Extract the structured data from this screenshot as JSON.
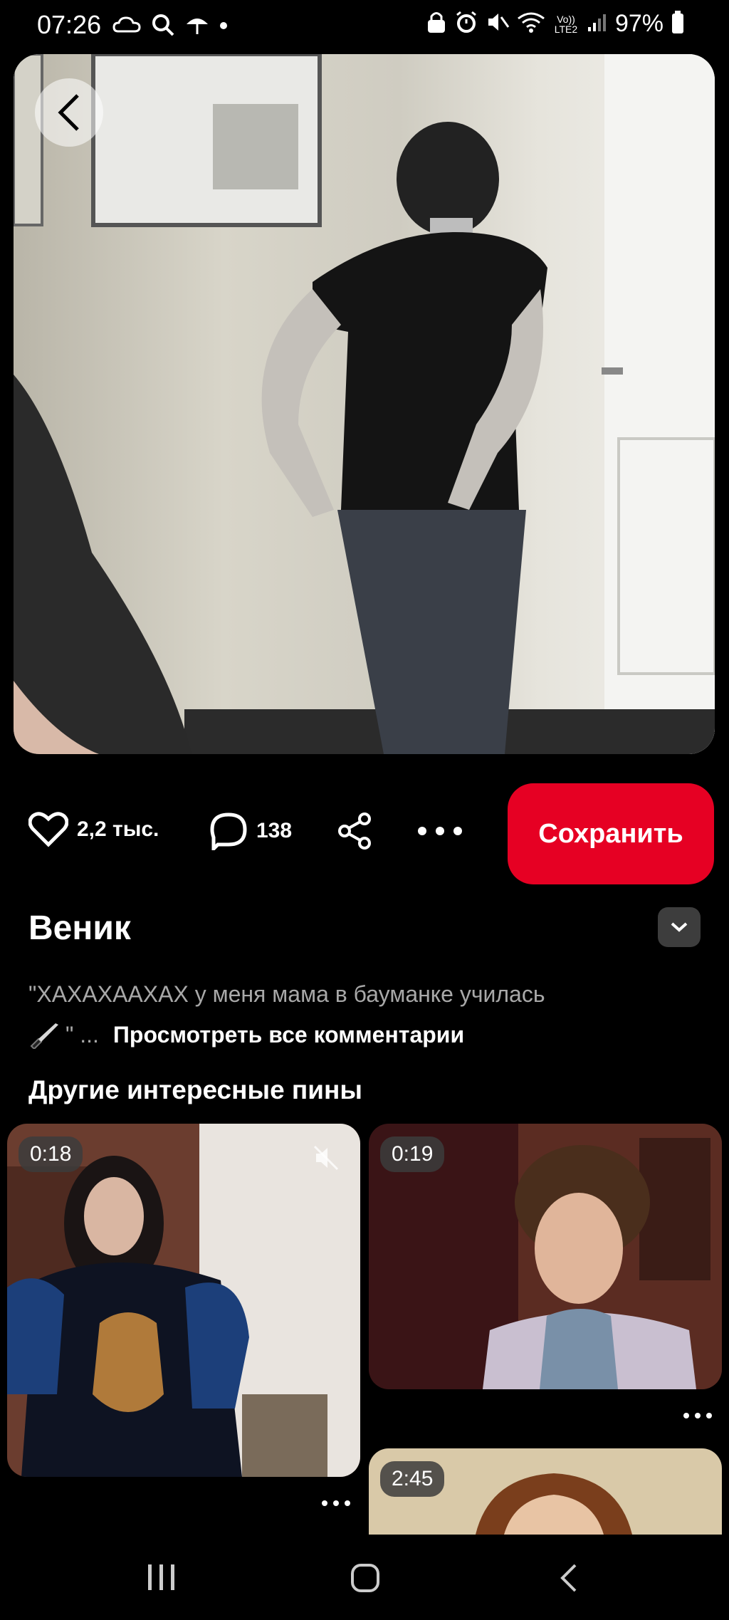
{
  "status_bar": {
    "time": "07:26",
    "battery": "97%",
    "left_icons": [
      "cloud-icon",
      "search-icon",
      "umbrella-icon",
      "dot-icon"
    ],
    "right_icons": [
      "lock-icon",
      "alarm-icon",
      "mute-icon",
      "wifi-icon",
      "volte-icon",
      "signal-icon",
      "battery-icon"
    ],
    "volte_label": "Vo)) LTE2"
  },
  "pin": {
    "likes": "2,2 тыс.",
    "comments": "138",
    "save_label": "Сохранить",
    "title": "Веник",
    "comment_preview": "\"ХАХАХААХАХ у меня мама в бауманке училась",
    "comment_tail": "\" ...",
    "view_all_comments": "Просмотреть все комментарии"
  },
  "more_section": {
    "title": "Другие интересные пины",
    "cards": [
      {
        "duration": "0:18",
        "muted": true
      },
      {
        "duration": "0:19"
      },
      {
        "duration": "2:45"
      }
    ]
  },
  "colors": {
    "accent": "#e60023",
    "background": "#000000",
    "muted_text": "#a8a8a8"
  }
}
